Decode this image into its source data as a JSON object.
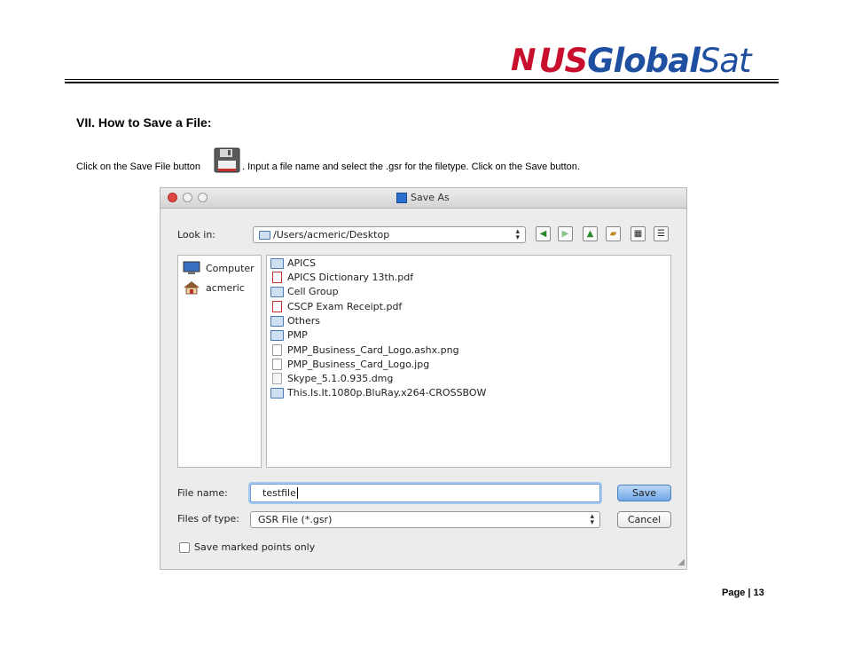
{
  "header": {
    "logo": {
      "mark": "N",
      "us": "US",
      "global": "Global",
      "sat": "Sat"
    }
  },
  "section": {
    "heading": "VII. How to Save a File:",
    "instruction_before": "Click on the Save File button",
    "instruction_after": ". Input a file name and select the .gsr for the filetype. Click on the Save button."
  },
  "dialog": {
    "title": "Save As",
    "look_in_label": "Look in:",
    "look_in_path": "/Users/acmeric/Desktop",
    "sidebar": [
      "Computer",
      "acmeric"
    ],
    "files": [
      {
        "name": "APICS",
        "kind": "folder"
      },
      {
        "name": "APICS Dictionary 13th.pdf",
        "kind": "pdf"
      },
      {
        "name": "Cell Group",
        "kind": "folder"
      },
      {
        "name": "CSCP Exam Receipt.pdf",
        "kind": "pdf"
      },
      {
        "name": "Others",
        "kind": "folder"
      },
      {
        "name": "PMP",
        "kind": "folder"
      },
      {
        "name": "PMP_Business_Card_Logo.ashx.png",
        "kind": "image"
      },
      {
        "name": "PMP_Business_Card_Logo.jpg",
        "kind": "image"
      },
      {
        "name": "Skype_5.1.0.935.dmg",
        "kind": "dmg"
      },
      {
        "name": "This.Is.It.1080p.BluRay.x264-CROSSBOW",
        "kind": "folder"
      }
    ],
    "file_name_label": "File name:",
    "file_name_value": "testfile",
    "file_type_label": "Files of type:",
    "file_type_value": "GSR File (*.gsr)",
    "save_label": "Save",
    "cancel_label": "Cancel",
    "checkbox_label": "Save marked points only"
  },
  "footer": {
    "page_label": "Page | 13"
  },
  "colors": {
    "logo_red": "#c8102e",
    "logo_blue": "#1f4fa0",
    "save_button": "#6fa6e6"
  }
}
